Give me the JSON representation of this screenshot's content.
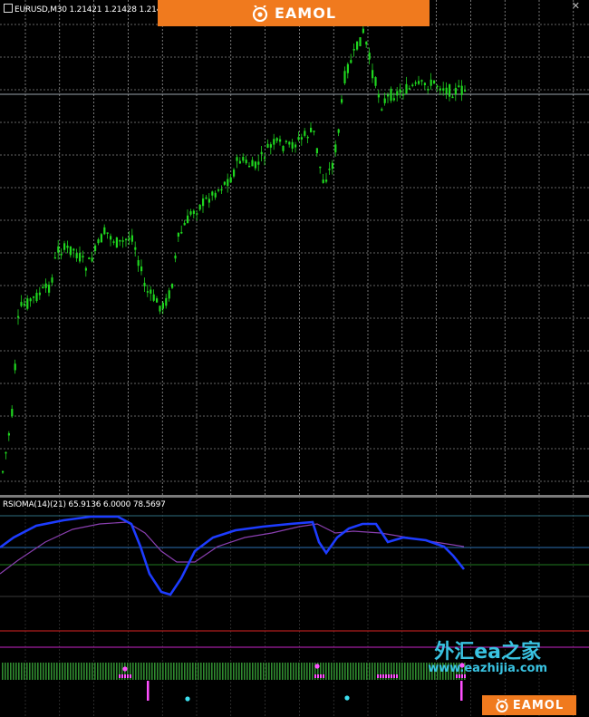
{
  "main_chart": {
    "header": "EURUSD,M30  1.21421  1.21428  1.214",
    "colors": {
      "background": "#000000",
      "candle": "#1fd61f",
      "grid": "#c8c8c8",
      "price_line": "#9aa3ad"
    }
  },
  "indicator": {
    "header": "RSIOMA(14)(21) 65.9136 6.0000 78.5697",
    "colors": {
      "rsioma_line": "#1d3cff",
      "signal_line": "#8a3fb0",
      "level_upper": "#2e6e80",
      "level_mid": "#2b6fb3",
      "level_green": "#1f7a1f",
      "level_red": "#b01e1e",
      "level_magenta": "#a01ea0",
      "histogram_green": "#2f8a2f",
      "histogram_pink": "#ff4fff",
      "dot_cyan": "#3de0f0"
    }
  },
  "branding": {
    "logo_text": "EAMOL",
    "logo_color": "#f07a1e",
    "watermark_cn": "外汇ea之家",
    "watermark_url": "www.eazhijia.com"
  }
}
